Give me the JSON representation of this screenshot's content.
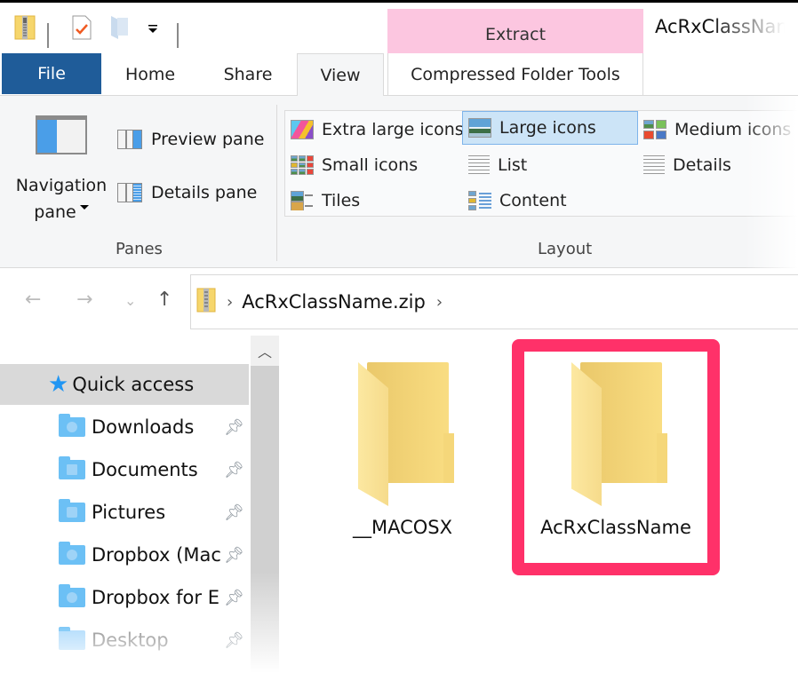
{
  "window": {
    "title": "AcRxClassName",
    "contextual_tab_group": "Extract"
  },
  "quick_access_toolbar": {
    "items": [
      {
        "name": "zip-folder-icon"
      },
      {
        "name": "properties-icon"
      },
      {
        "name": "new-folder-icon"
      },
      {
        "name": "customize-dropdown-icon"
      }
    ]
  },
  "ribbon_tabs": [
    {
      "label": "File",
      "active": false
    },
    {
      "label": "Home",
      "active": false
    },
    {
      "label": "Share",
      "active": false
    },
    {
      "label": "View",
      "active": true
    },
    {
      "label": "Compressed Folder Tools",
      "active": false
    }
  ],
  "ribbon": {
    "panes_group": {
      "label": "Panes",
      "navigation_pane": {
        "line1": "Navigation",
        "line2": "pane"
      },
      "preview_pane": "Preview pane",
      "details_pane": "Details pane"
    },
    "layout_group": {
      "label": "Layout",
      "options": [
        {
          "label": "Extra large icons",
          "selected": false
        },
        {
          "label": "Large icons",
          "selected": true
        },
        {
          "label": "Medium icons",
          "selected": false
        },
        {
          "label": "Small icons",
          "selected": false
        },
        {
          "label": "List",
          "selected": false
        },
        {
          "label": "Details",
          "selected": false
        },
        {
          "label": "Tiles",
          "selected": false
        },
        {
          "label": "Content",
          "selected": false
        }
      ]
    }
  },
  "address_bar": {
    "back": "←",
    "forward": "→",
    "recent": "⌄",
    "up": "↑",
    "breadcrumb": [
      "AcRxClassName.zip"
    ],
    "separator": "›"
  },
  "navigation_tree": {
    "items": [
      {
        "label": "Quick access",
        "selected": true,
        "icon": "star-icon"
      },
      {
        "label": "Downloads",
        "pinned": true,
        "icon": "downloads-folder-icon"
      },
      {
        "label": "Documents",
        "pinned": true,
        "icon": "documents-folder-icon"
      },
      {
        "label": "Pictures",
        "pinned": true,
        "icon": "pictures-folder-icon"
      },
      {
        "label": "Dropbox (Mac",
        "pinned": true,
        "icon": "dropbox-folder-icon"
      },
      {
        "label": "Dropbox for E",
        "pinned": true,
        "icon": "dropbox-folder-icon"
      },
      {
        "label": "Desktop",
        "pinned": true,
        "icon": "desktop-folder-icon"
      }
    ]
  },
  "files": [
    {
      "name": "__MACOSX",
      "type": "folder",
      "highlighted": false
    },
    {
      "name": "AcRxClassName",
      "type": "folder",
      "highlighted": true
    }
  ],
  "colors": {
    "file_tab": "#1f5c99",
    "contextual_tab": "#fcc6e0",
    "selection": "#cce4f7",
    "highlight_annotation": "#ff3169"
  }
}
